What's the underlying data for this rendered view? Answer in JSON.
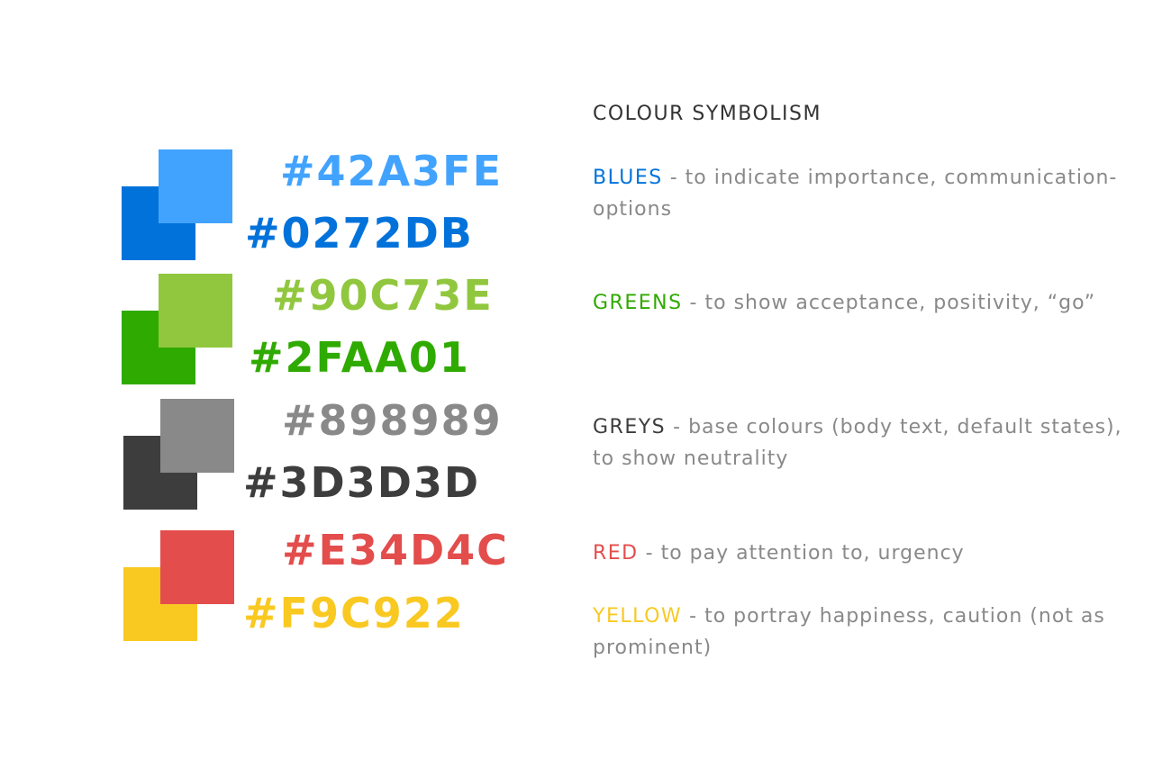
{
  "title": "COLOUR SYMBOLISM",
  "palette": [
    {
      "light": {
        "hex": "#42A3FE",
        "color": "#42A3FE"
      },
      "dark": {
        "hex": "#0272DB",
        "color": "#0272DB"
      }
    },
    {
      "light": {
        "hex": "#90C73E",
        "color": "#90C73E"
      },
      "dark": {
        "hex": "#2FAA01",
        "color": "#2FAA01"
      }
    },
    {
      "light": {
        "hex": "#898989",
        "color": "#898989"
      },
      "dark": {
        "hex": "#3D3D3D",
        "color": "#3D3D3D"
      }
    },
    {
      "light": {
        "hex": "#E34D4C",
        "color": "#E34D4C"
      },
      "dark": {
        "hex": "#F9C922",
        "color": "#F9C922"
      }
    }
  ],
  "symbolism": [
    {
      "keyword": "BLUES",
      "keyword_color": "#0272DB",
      "text": " - to indicate importance, communication-options"
    },
    {
      "keyword": "GREENS",
      "keyword_color": "#2FAA01",
      "text": " - to show acceptance, positivity, “go”"
    },
    {
      "keyword": "GREYS",
      "keyword_color": "#3D3D3D",
      "text": " - base colours (body text, default states), to show neutrality"
    },
    {
      "keyword": "RED",
      "keyword_color": "#E34D4C",
      "text": " - to pay attention to, urgency"
    },
    {
      "keyword": "YELLOW",
      "keyword_color": "#F9C922",
      "text": " - to portray happiness, caution (not as prominent)"
    }
  ],
  "text_color": "#898989"
}
